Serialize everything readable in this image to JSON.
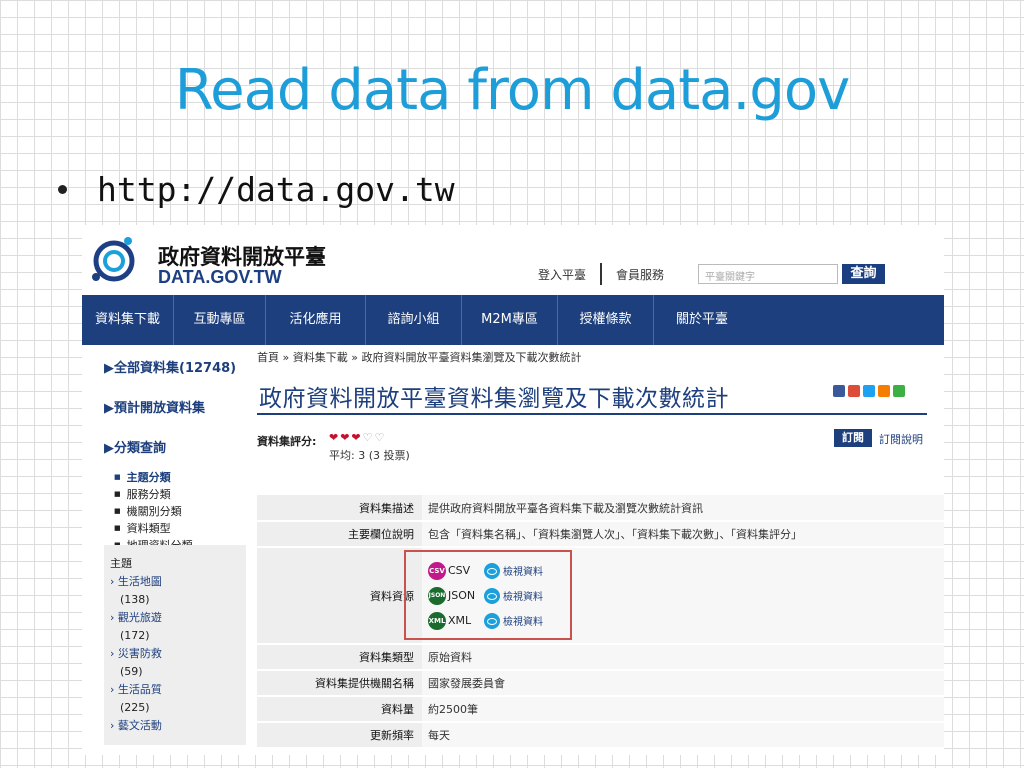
{
  "slide": {
    "title": "Read data from data.gov",
    "bullet": "http://data.gov.tw"
  },
  "site": {
    "logo_cn": "政府資料開放平臺",
    "logo_en": "DATA.GOV.TW",
    "login": "登入平臺",
    "member": "會員服務",
    "search_placeholder": "平臺關鍵字",
    "search_button": "查詢",
    "nav": [
      "資料集下載",
      "互動專區",
      "活化應用",
      "諮詢小組",
      "M2M專區",
      "授權條款",
      "關於平臺"
    ]
  },
  "sidebar": {
    "all_datasets": "▶全部資料集(12748)",
    "planned": "▶預計開放資料集",
    "category_query": "▶分類查詢",
    "sub_items": [
      "主題分類",
      "服務分類",
      "機關別分類",
      "資料類型",
      "地理資料分類"
    ],
    "theme_heading": "主題",
    "themes": [
      {
        "name": "› 生活地圖",
        "count": "(138)"
      },
      {
        "name": "› 觀光旅遊",
        "count": "(172)"
      },
      {
        "name": "› 災害防救",
        "count": "(59)"
      },
      {
        "name": "› 生活品質",
        "count": "(225)"
      },
      {
        "name": "› 藝文活動",
        "count": ""
      }
    ]
  },
  "main": {
    "breadcrumb": "首頁 » 資料集下載 » 政府資料開放平臺資料集瀏覽及下載次數統計",
    "title": "政府資料開放平臺資料集瀏覽及下載次數統計",
    "rating_label": "資料集評分:",
    "hearts_full": "❤❤❤",
    "hearts_empty": "♡♡",
    "average": "平均: 3 (3 投票)",
    "subscribe": "訂閱",
    "subscribe_help": "訂閱說明",
    "rows": {
      "desc_key": "資料集描述",
      "desc_val": "提供政府資料開放平臺各資料集下載及瀏覽次數統計資訊",
      "fields_key": "主要欄位說明",
      "fields_val": "包含「資料集名稱」、「資料集瀏覽人次」、「資料集下載次數」、「資料集評分」",
      "resource_key": "資料資源",
      "type_key": "資料集類型",
      "type_val": "原始資料",
      "org_key": "資料集提供機關名稱",
      "org_val": "國家發展委員會",
      "amount_key": "資料量",
      "amount_val": "約2500筆",
      "freq_key": "更新頻率",
      "freq_val": "每天"
    },
    "resources": [
      {
        "badge": "CSV",
        "label": "CSV",
        "view": "檢視資料",
        "color": "#c2188b"
      },
      {
        "badge": "JSON",
        "label": "JSON",
        "view": "檢視資料",
        "color": "#1b6b2e"
      },
      {
        "badge": "XML",
        "label": "XML",
        "view": "檢視資料",
        "color": "#1b6b2e"
      }
    ]
  }
}
